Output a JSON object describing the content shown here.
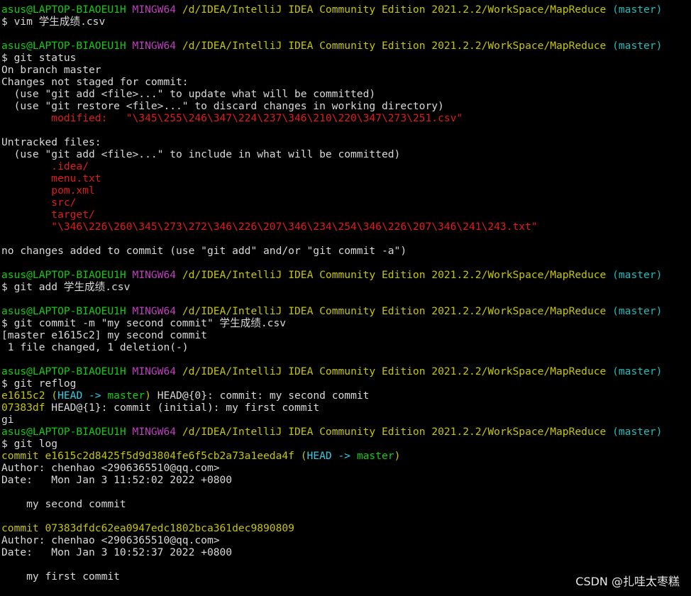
{
  "prompt": {
    "user_host": "asus@LAPTOP-BIAOEU1H",
    "system": "MINGW64",
    "path": "/d/IDEA/IntelliJ IDEA Community Edition 2021.2.2/WorkSpace/MapReduce",
    "branch": "(master)"
  },
  "lines": [
    {
      "type": "prompt"
    },
    {
      "type": "text",
      "segments": [
        {
          "t": "$ vim 学生成绩.csv"
        }
      ]
    },
    {
      "type": "blank"
    },
    {
      "type": "prompt"
    },
    {
      "type": "text",
      "segments": [
        {
          "t": "$ git status"
        }
      ]
    },
    {
      "type": "text",
      "segments": [
        {
          "t": "On branch master"
        }
      ]
    },
    {
      "type": "text",
      "segments": [
        {
          "t": "Changes not staged for commit:"
        }
      ]
    },
    {
      "type": "text",
      "segments": [
        {
          "t": "  (use \"git add <file>...\" to update what will be committed)"
        }
      ]
    },
    {
      "type": "text",
      "segments": [
        {
          "t": "  (use \"git restore <file>...\" to discard changes in working directory)"
        }
      ]
    },
    {
      "type": "text",
      "segments": [
        {
          "t": "        modified:   \"\\345\\255\\246\\347\\224\\237\\346\\210\\220\\347\\273\\251.csv\"",
          "c": "red"
        }
      ]
    },
    {
      "type": "blank"
    },
    {
      "type": "text",
      "segments": [
        {
          "t": "Untracked files:"
        }
      ]
    },
    {
      "type": "text",
      "segments": [
        {
          "t": "  (use \"git add <file>...\" to include in what will be committed)"
        }
      ]
    },
    {
      "type": "text",
      "segments": [
        {
          "t": "        .idea/",
          "c": "red"
        }
      ]
    },
    {
      "type": "text",
      "segments": [
        {
          "t": "        menu.txt",
          "c": "red"
        }
      ]
    },
    {
      "type": "text",
      "segments": [
        {
          "t": "        pom.xml",
          "c": "red"
        }
      ]
    },
    {
      "type": "text",
      "segments": [
        {
          "t": "        src/",
          "c": "red"
        }
      ]
    },
    {
      "type": "text",
      "segments": [
        {
          "t": "        target/",
          "c": "red"
        }
      ]
    },
    {
      "type": "text",
      "segments": [
        {
          "t": "        \"\\346\\226\\260\\345\\273\\272\\346\\226\\207\\346\\234\\254\\346\\226\\207\\346\\241\\243.txt\"",
          "c": "red"
        }
      ]
    },
    {
      "type": "blank"
    },
    {
      "type": "text",
      "segments": [
        {
          "t": "no changes added to commit (use \"git add\" and/or \"git commit -a\")"
        }
      ]
    },
    {
      "type": "blank"
    },
    {
      "type": "prompt"
    },
    {
      "type": "text",
      "segments": [
        {
          "t": "$ git add 学生成绩.csv"
        }
      ]
    },
    {
      "type": "blank"
    },
    {
      "type": "prompt"
    },
    {
      "type": "text",
      "segments": [
        {
          "t": "$ git commit -m \"my second commit\" 学生成绩.csv"
        }
      ]
    },
    {
      "type": "text",
      "segments": [
        {
          "t": "[master e1615c2] my second commit"
        }
      ]
    },
    {
      "type": "text",
      "segments": [
        {
          "t": " 1 file changed, 1 deletion(-)"
        }
      ]
    },
    {
      "type": "blank"
    },
    {
      "type": "prompt"
    },
    {
      "type": "text",
      "segments": [
        {
          "t": "$ git reflog"
        }
      ]
    },
    {
      "type": "text",
      "segments": [
        {
          "t": "e1615c2 ",
          "c": "yellow"
        },
        {
          "t": "(",
          "c": "yellow"
        },
        {
          "t": "HEAD -> ",
          "c": "cyan"
        },
        {
          "t": "master",
          "c": "green"
        },
        {
          "t": ")",
          "c": "yellow"
        },
        {
          "t": " HEAD@{0}: commit: my second commit"
        }
      ]
    },
    {
      "type": "text",
      "segments": [
        {
          "t": "07383df ",
          "c": "yellow"
        },
        {
          "t": "HEAD@{1}: commit (initial): my first commit"
        }
      ]
    },
    {
      "type": "text",
      "segments": [
        {
          "t": "gi"
        }
      ]
    },
    {
      "type": "prompt"
    },
    {
      "type": "text",
      "segments": [
        {
          "t": "$ git log"
        }
      ]
    },
    {
      "type": "text",
      "segments": [
        {
          "t": "commit e1615c2d8425f5d9d3804fe6f5cb2a73a1eeda4f ",
          "c": "yellow"
        },
        {
          "t": "(",
          "c": "yellow"
        },
        {
          "t": "HEAD -> ",
          "c": "cyan"
        },
        {
          "t": "master",
          "c": "green"
        },
        {
          "t": ")",
          "c": "yellow"
        }
      ]
    },
    {
      "type": "text",
      "segments": [
        {
          "t": "Author: chenhao <2906365510@qq.com>"
        }
      ]
    },
    {
      "type": "text",
      "segments": [
        {
          "t": "Date:   Mon Jan 3 11:52:02 2022 +0800"
        }
      ]
    },
    {
      "type": "blank"
    },
    {
      "type": "text",
      "segments": [
        {
          "t": "    my second commit"
        }
      ]
    },
    {
      "type": "blank"
    },
    {
      "type": "text",
      "segments": [
        {
          "t": "commit 07383dfdc62ea0947edc1802bca361dec9890809",
          "c": "yellow"
        }
      ]
    },
    {
      "type": "text",
      "segments": [
        {
          "t": "Author: chenhao <2906365510@qq.com>"
        }
      ]
    },
    {
      "type": "text",
      "segments": [
        {
          "t": "Date:   Mon Jan 3 10:52:37 2022 +0800"
        }
      ]
    },
    {
      "type": "blank"
    },
    {
      "type": "text",
      "segments": [
        {
          "t": "    my first commit"
        }
      ]
    }
  ],
  "watermark": "CSDN @扎哇太枣糕"
}
